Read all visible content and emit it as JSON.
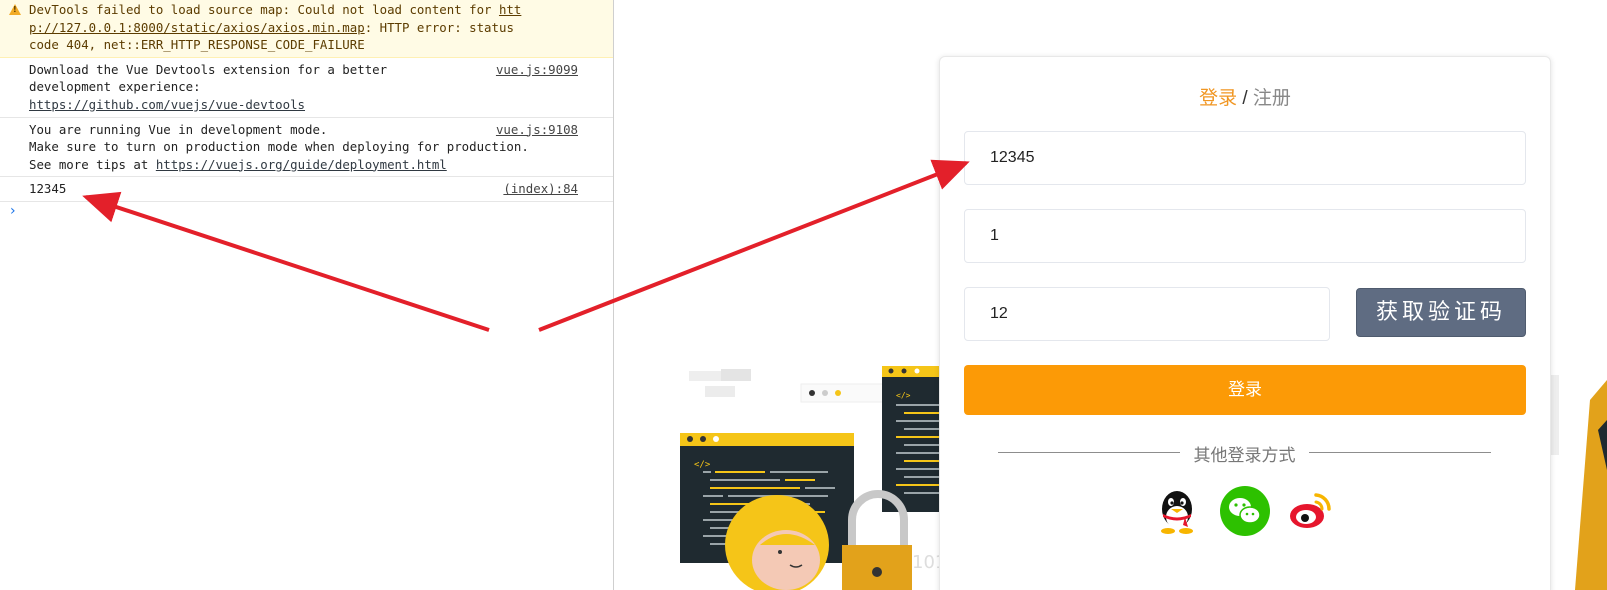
{
  "console": {
    "warning": {
      "text": "DevTools failed to load source map: Could not load content for ",
      "link": "http://127.0.0.1:8000/static/axios/axios.min.map",
      "link_line1": "htt",
      "link_line2": "p://127.0.0.1:8000/static/axios/axios.min.map",
      "rest_line2": ": HTTP error: status",
      "rest_line3": "code 404, net::ERR_HTTP_RESPONSE_CODE_FAILURE"
    },
    "messages": [
      {
        "line1": "Download the Vue Devtools extension for a better",
        "line2": "development experience:",
        "link": "https://github.com/vuejs/vue-devtools",
        "source": "vue.js:9099"
      },
      {
        "line1": "You are running Vue in development mode.",
        "line2": "Make sure to turn on production mode when deploying for production.",
        "line3_prefix": "See more tips at ",
        "link": "https://vuejs.org/guide/deployment.html",
        "source": "vue.js:9108"
      },
      {
        "line1": "12345",
        "source": "(index):84"
      }
    ],
    "prompt": "›"
  },
  "login": {
    "title_active": "登录",
    "title_sep": " / ",
    "title_other": "注册",
    "phone_value": "12345",
    "password_value": "1",
    "code_value": "12",
    "code_button": "获取验证码",
    "submit_button": "登录",
    "other_methods": "其他登录方式",
    "social": [
      "qq-icon",
      "wechat-icon",
      "weibo-icon"
    ]
  },
  "colors": {
    "accent": "#fc9a06",
    "title_active": "#f09622",
    "code_button": "#5f6c82",
    "arrow": "#e3202a",
    "wechat": "#2dc100",
    "weibo": "#e6162d"
  }
}
